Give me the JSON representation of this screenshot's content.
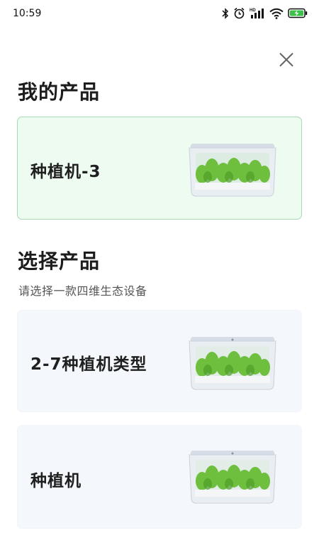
{
  "status_bar": {
    "time": "10:59",
    "icons": [
      "bluetooth-icon",
      "alarm-icon",
      "hd-signal-icon",
      "wifi-icon",
      "battery-charging-icon"
    ],
    "hd_label": "HD"
  },
  "header": {
    "close_icon": "close-icon"
  },
  "my_products": {
    "title": "我的产品",
    "items": [
      {
        "label": "种植机-3",
        "image_icon": "planter-image"
      }
    ]
  },
  "select_products": {
    "title": "选择产品",
    "subtitle": "请选择一款四维生态设备",
    "items": [
      {
        "label": "2-7种植机类型",
        "image_icon": "planter-image"
      },
      {
        "label": "种植机",
        "image_icon": "planter-image"
      }
    ]
  },
  "colors": {
    "active_card_bg": "#eefbf1",
    "active_card_border": "#a7d9b3",
    "plain_card_bg": "#f4f7fb",
    "battery_green": "#3cc24a"
  }
}
